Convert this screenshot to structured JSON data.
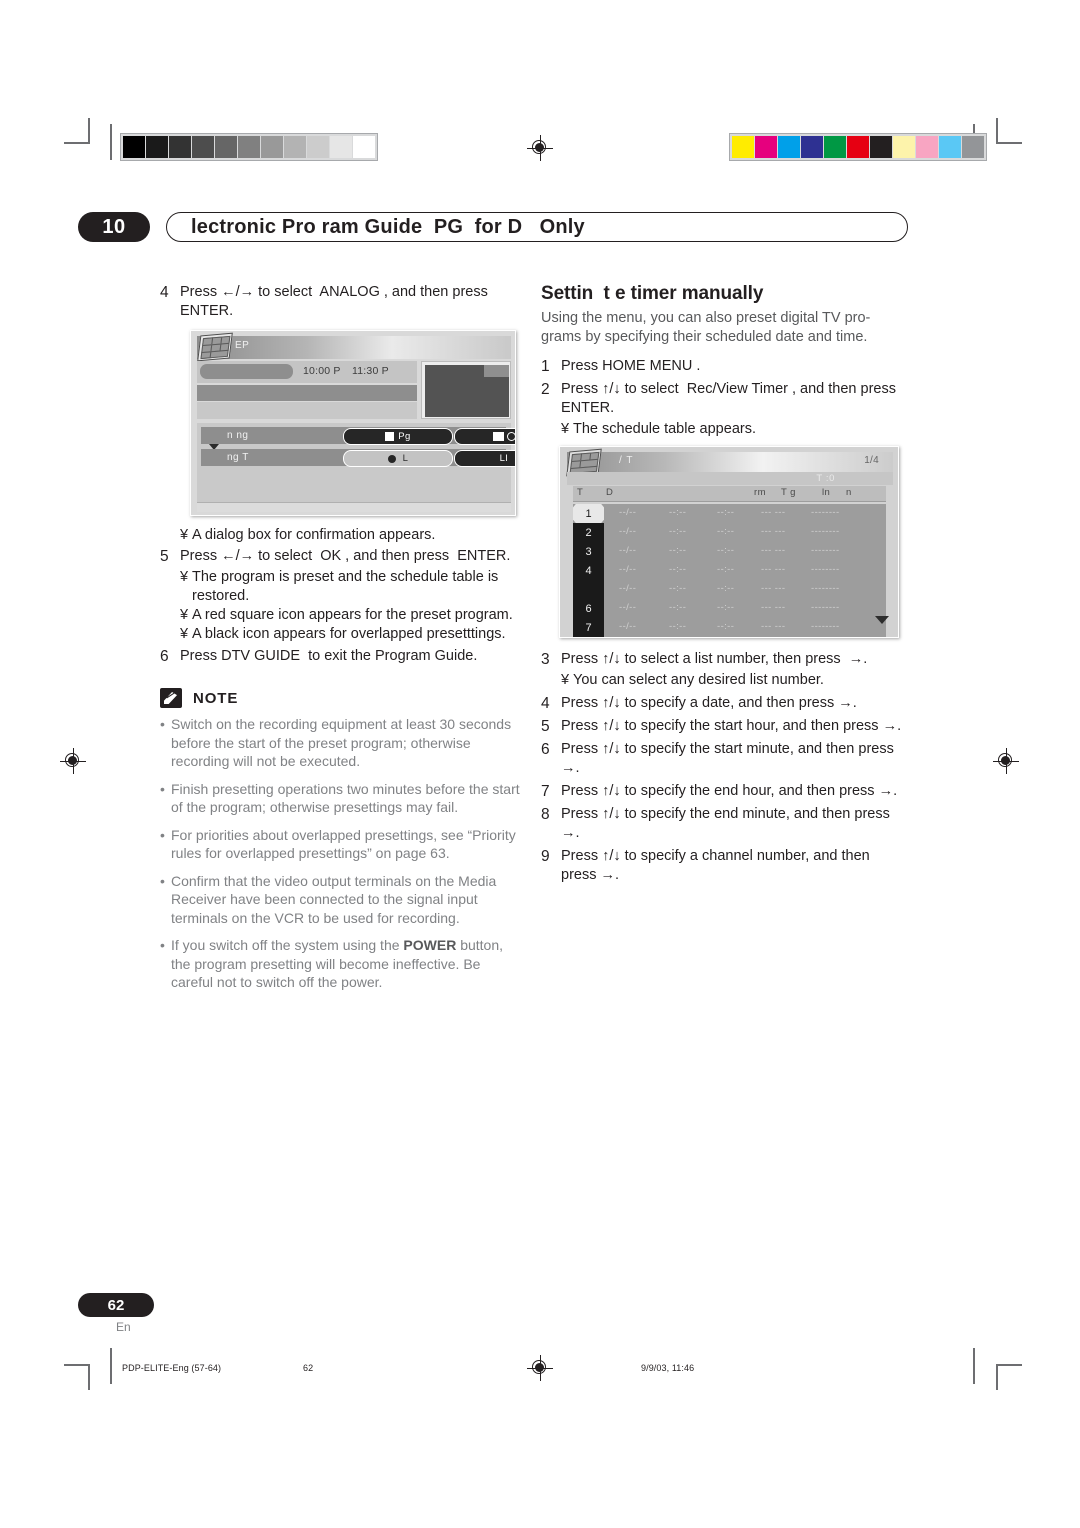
{
  "header": {
    "chapter_number": "10",
    "chapter_title": "lectronic Pro ram Guide  PG  for D   Only"
  },
  "left_column": {
    "step4": {
      "number": "4",
      "text": "Press ←/→ to select  ANALOG , and then press ENTER."
    },
    "epg_screenshot": {
      "title": "EP",
      "time_start": "10:00 P",
      "time_end": "11:30 P",
      "option_row1_label": "n    ng",
      "option_row1_pill1": "Pg",
      "option_row1_pill2": "",
      "option_row2_label": "ng T",
      "option_row2_pill1": "L",
      "option_row2_pill2": "LI"
    },
    "note_after_shot": "A dialog box for confirmation appears.",
    "step5": {
      "number": "5",
      "text": "Press ←/→ to select  OK , and then press  ENTER.",
      "subs": [
        "The program is preset and the schedule table is restored.",
        "A red square icon appears for the preset program.",
        "A black icon appears for overlapped presetttings."
      ]
    },
    "step6": {
      "number": "6",
      "text": "Press DTV GUIDE  to exit the Program Guide."
    },
    "note": {
      "label": "NOTE",
      "items": [
        "Switch on the recording equipment at least 30 seconds before the start of the preset program; otherwise recording will not be executed.",
        "Finish presetting operations two minutes before the start of the program; otherwise presettings may fail.",
        "For priorities about overlapped presettings, see “Priority rules for overlapped presettings” on page 63.",
        "Confirm that the video output terminals on the Media Receiver have been connected to the signal input terminals on the VCR to be used for recording.",
        "If you switch off the system using the POWER button, the program presetting will become ineffective. Be careful not to switch off the power."
      ]
    }
  },
  "right_column": {
    "heading": "Settin  t e timer manually",
    "intro": "Using the menu, you can also preset digital TV pro-grams by specifying their scheduled date and time.",
    "step1": {
      "number": "1",
      "text": "Press HOME MENU ."
    },
    "step2": {
      "number": "2",
      "text": "Press ↑/↓ to select  Rec/View Timer , and then press ENTER.",
      "sub": "The schedule table appears."
    },
    "schedule_screenshot": {
      "title": "/  T",
      "page_indicator": "1/4",
      "total_label": "T  :0",
      "columns": [
        "T",
        "D",
        "rm",
        "T g",
        "ln",
        "n"
      ],
      "rows": [
        {
          "num": "1",
          "date": "--/--",
          "start": "--:--",
          "end": "--:--",
          "ch": "--- ---",
          "title": "--------",
          "selected": true
        },
        {
          "num": "2",
          "date": "--/--",
          "start": "--:--",
          "end": "--:--",
          "ch": "--- ---",
          "title": "--------",
          "selected": false
        },
        {
          "num": "3",
          "date": "--/--",
          "start": "--:--",
          "end": "--:--",
          "ch": "--- ---",
          "title": "--------",
          "selected": false
        },
        {
          "num": "4",
          "date": "--/--",
          "start": "--:--",
          "end": "--:--",
          "ch": "--- ---",
          "title": "--------",
          "selected": false
        },
        {
          "num": "",
          "date": "--/--",
          "start": "--:--",
          "end": "--:--",
          "ch": "--- ---",
          "title": "--------",
          "selected": false
        },
        {
          "num": "6",
          "date": "--/--",
          "start": "--:--",
          "end": "--:--",
          "ch": "--- ---",
          "title": "--------",
          "selected": false
        },
        {
          "num": "7",
          "date": "--/--",
          "start": "--:--",
          "end": "--:--",
          "ch": "--- ---",
          "title": "--------",
          "selected": false
        }
      ]
    },
    "step3": {
      "number": "3",
      "text": "Press ↑/↓ to select a list number, then press  →.",
      "sub": "You can select any desired list number."
    },
    "step4": {
      "number": "4",
      "text": "Press ↑/↓ to specify a date, and then press →."
    },
    "step5": {
      "number": "5",
      "text": "Press ↑/↓ to specify the start hour, and then press →."
    },
    "step6": {
      "number": "6",
      "text": "Press ↑/↓ to specify the start minute, and then press →."
    },
    "step7": {
      "number": "7",
      "text": "Press ↑/↓ to specify the end hour, and then press →."
    },
    "step8": {
      "number": "8",
      "text": "Press ↑/↓ to specify the end minute, and then press →."
    },
    "step9": {
      "number": "9",
      "text": "Press ↑/↓ to specify a channel number, and then press →."
    }
  },
  "bullet_glyph": "¥",
  "note_bullet_glyph": "•",
  "footer": {
    "page_number": "62",
    "language": "En",
    "print_file": "PDP-ELITE-Eng (57-64)",
    "print_page": "62",
    "print_date": "9/9/03, 11:46"
  },
  "calibration": {
    "grayscale": [
      "#000000",
      "#1a1a1a",
      "#333333",
      "#4d4d4d",
      "#666666",
      "#808080",
      "#999999",
      "#b3b3b3",
      "#cccccc",
      "#e6e6e6",
      "#ffffff"
    ],
    "colors": [
      "#ffec00",
      "#e6007e",
      "#00a0e9",
      "#2e3192",
      "#009844",
      "#e60012",
      "#231f20",
      "#fdf3ab",
      "#f8a5c2",
      "#5ac8f5",
      "#939598"
    ]
  }
}
